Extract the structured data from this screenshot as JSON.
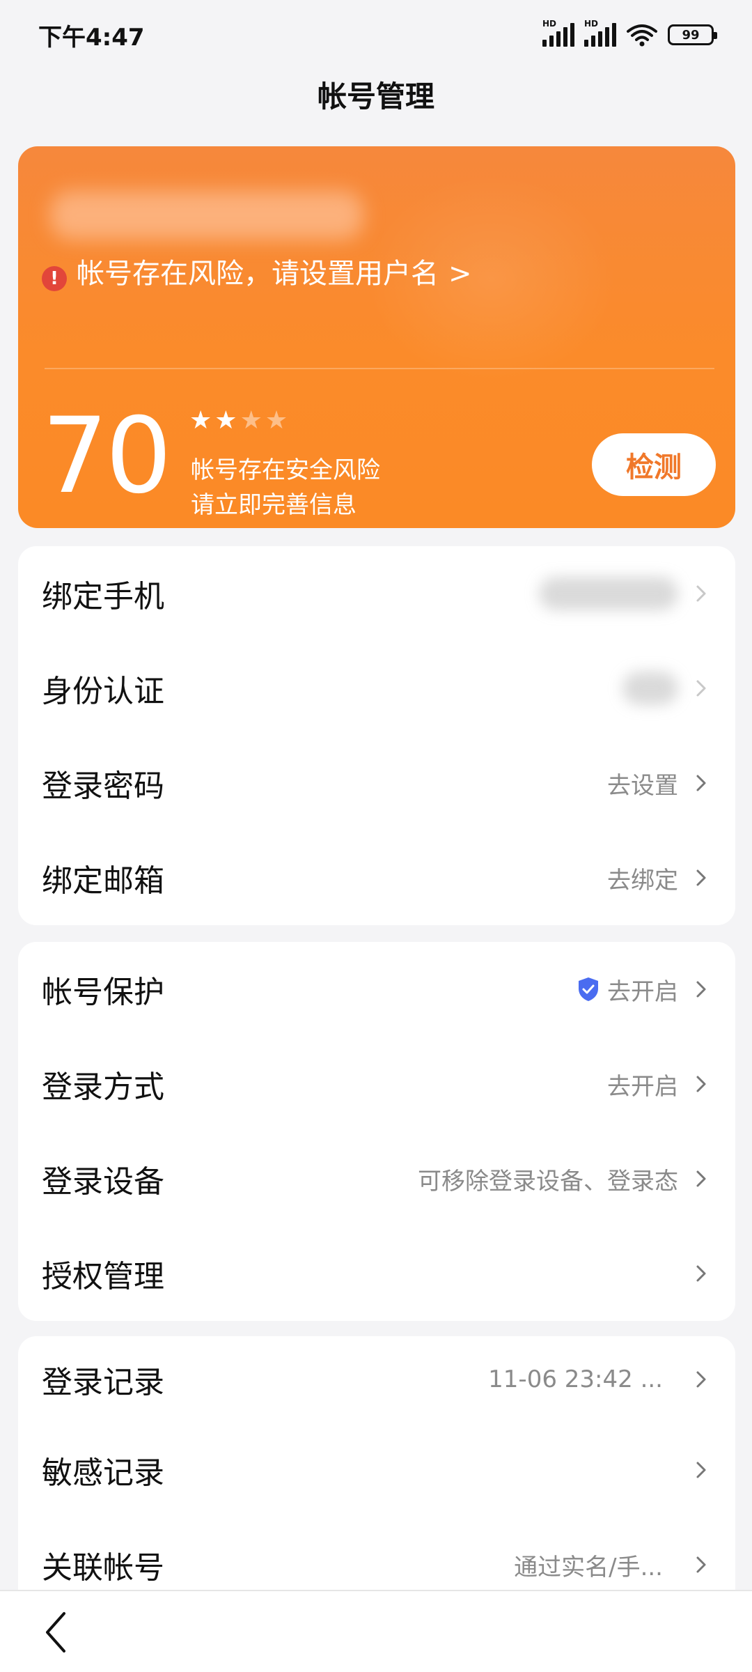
{
  "status_bar": {
    "time": "下午4:47",
    "hd1": "HD",
    "hd2": "HD",
    "battery": "99"
  },
  "page": {
    "title": "帐号管理"
  },
  "risk_card": {
    "warning": "帐号存在风险，请设置用户名",
    "score": "70",
    "stars_total": 4,
    "stars_filled": 2,
    "line1": "帐号存在安全风险",
    "line2": "请立即完善信息",
    "check_label": "检测",
    "accent_color": "#fb8a26"
  },
  "group1": {
    "items": [
      {
        "label": "绑定手机",
        "value": ""
      },
      {
        "label": "身份认证",
        "value": ""
      },
      {
        "label": "登录密码",
        "value": "去设置"
      },
      {
        "label": "绑定邮箱",
        "value": "去绑定"
      }
    ]
  },
  "group2": {
    "items": [
      {
        "label": "帐号保护",
        "value": "去开启",
        "icon": "shield-check-icon"
      },
      {
        "label": "登录方式",
        "value": "去开启"
      },
      {
        "label": "登录设备",
        "value": "可移除登录设备、登录态"
      },
      {
        "label": "授权管理",
        "value": ""
      }
    ]
  },
  "group3": {
    "items": [
      {
        "label": "登录记录",
        "value": "11-06 23:42 ..."
      },
      {
        "label": "敏感记录",
        "value": ""
      },
      {
        "label": "关联帐号",
        "value": "通过实名/手..."
      }
    ]
  },
  "nav": {
    "back_icon": "back-arrow-icon"
  }
}
